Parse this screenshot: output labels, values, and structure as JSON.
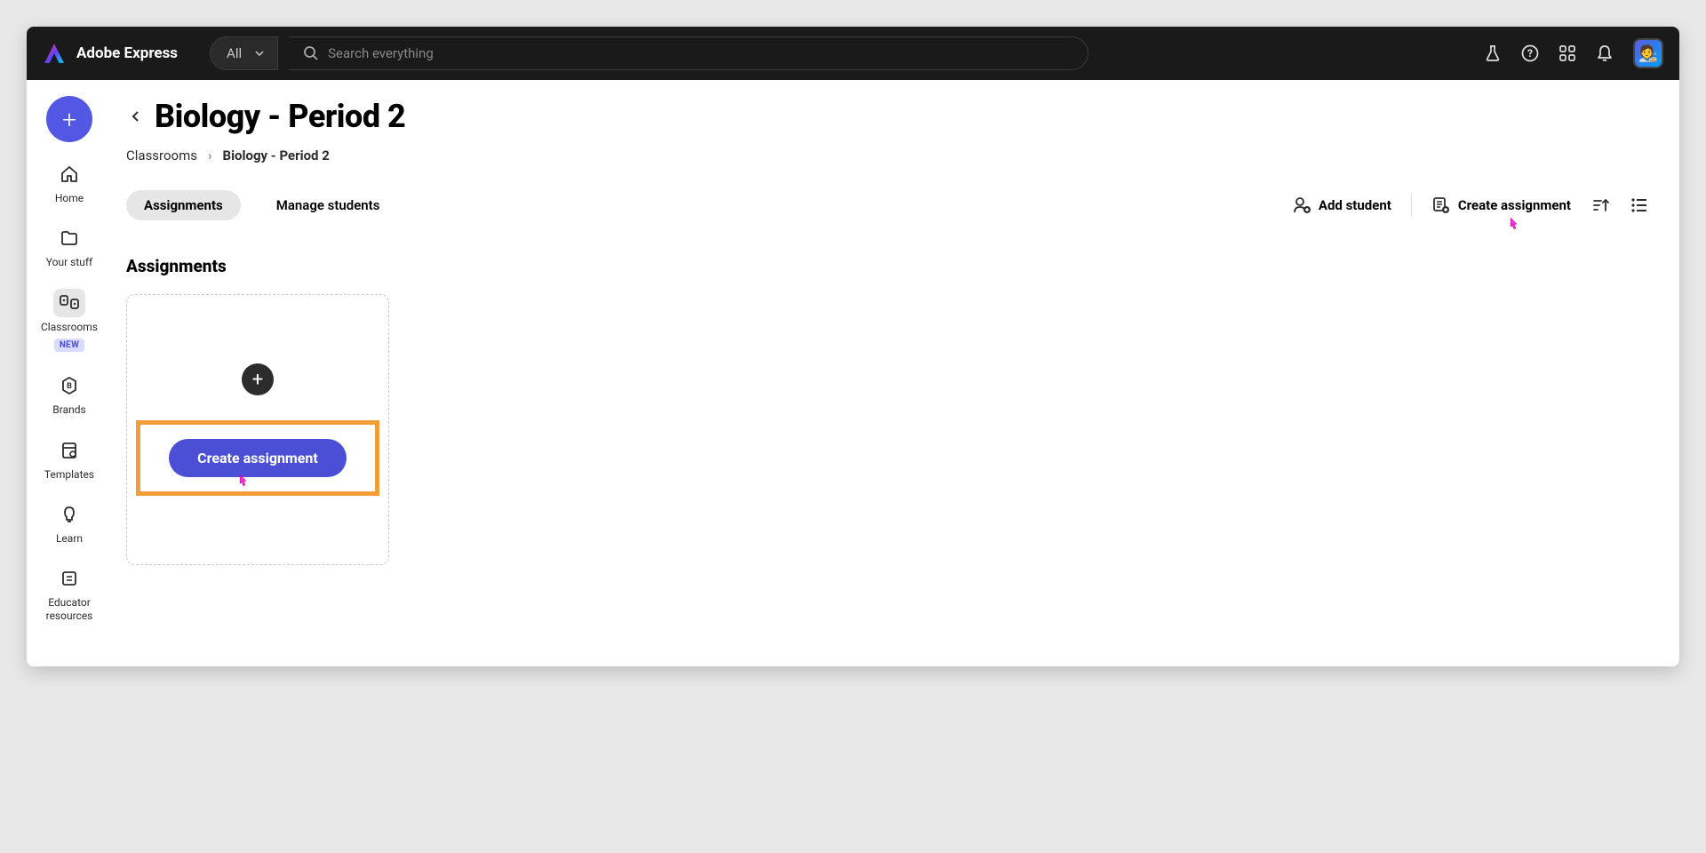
{
  "header": {
    "app_name": "Adobe Express",
    "filter_label": "All",
    "search_placeholder": "Search everything"
  },
  "sidebar": {
    "items": [
      {
        "label": "Home",
        "icon": "home-icon"
      },
      {
        "label": "Your stuff",
        "icon": "folder-icon"
      },
      {
        "label": "Classrooms",
        "icon": "classrooms-icon",
        "badge": "NEW"
      },
      {
        "label": "Brands",
        "icon": "brands-icon"
      },
      {
        "label": "Templates",
        "icon": "templates-icon"
      },
      {
        "label": "Learn",
        "icon": "learn-icon"
      },
      {
        "label": "Educator resources",
        "icon": "educator-icon"
      }
    ]
  },
  "main": {
    "title": "Biology - Period 2",
    "breadcrumb": {
      "root": "Classrooms",
      "current": "Biology - Period 2"
    },
    "tabs": {
      "assignments": "Assignments",
      "manage": "Manage students"
    },
    "actions": {
      "add_student": "Add student",
      "create_assignment": "Create assignment"
    },
    "section_title": "Assignments",
    "card_button": "Create assignment"
  }
}
